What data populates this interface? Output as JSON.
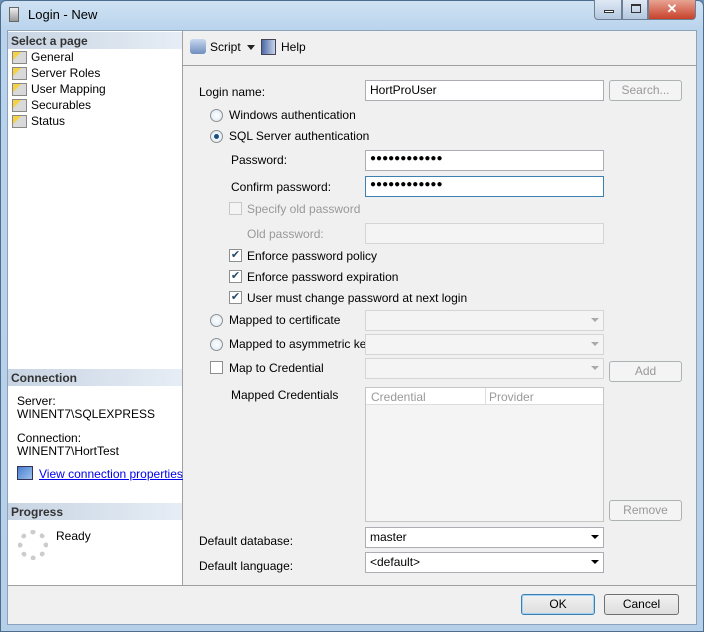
{
  "window": {
    "title": "Login - New",
    "close_glyph": "✕"
  },
  "left": {
    "select_header": "Select a page",
    "pages": [
      "General",
      "Server Roles",
      "User Mapping",
      "Securables",
      "Status"
    ],
    "connection_header": "Connection",
    "server_label": "Server:",
    "server_value": "WINENT7\\SQLEXPRESS",
    "connection_label": "Connection:",
    "connection_value": "WINENT7\\HortTest",
    "view_link": "View connection properties",
    "progress_header": "Progress",
    "progress_status": "Ready"
  },
  "toolbar": {
    "script": "Script",
    "help": "Help"
  },
  "form": {
    "login_name_label": "Login name:",
    "login_name_value": "HortProUser",
    "search": "Search...",
    "windows_auth": "Windows authentication",
    "sql_auth": "SQL Server authentication",
    "auth_selected": "sql",
    "password_label": "Password:",
    "password_value": "●●●●●●●●●●●●",
    "confirm_label": "Confirm password:",
    "confirm_value": "●●●●●●●●●●●●",
    "specify_old": "Specify old password",
    "old_password_label": "Old password:",
    "enforce_policy": "Enforce password policy",
    "enforce_expiration": "Enforce password expiration",
    "must_change": "User must change password at next login",
    "checks": {
      "specify_old": false,
      "enforce_policy": true,
      "enforce_expiration": true,
      "must_change": true,
      "map_credential": false
    },
    "mapped_cert": "Mapped to certificate",
    "mapped_asym": "Mapped to asymmetric key",
    "map_credential": "Map to Credential",
    "add": "Add",
    "mapped_credentials": "Mapped Credentials",
    "grid_columns": [
      "Credential",
      "Provider"
    ],
    "remove": "Remove",
    "default_db_label": "Default database:",
    "default_db_value": "master",
    "default_lang_label": "Default language:",
    "default_lang_value": "<default>"
  },
  "footer": {
    "ok": "OK",
    "cancel": "Cancel"
  },
  "check_glyph": "✔"
}
